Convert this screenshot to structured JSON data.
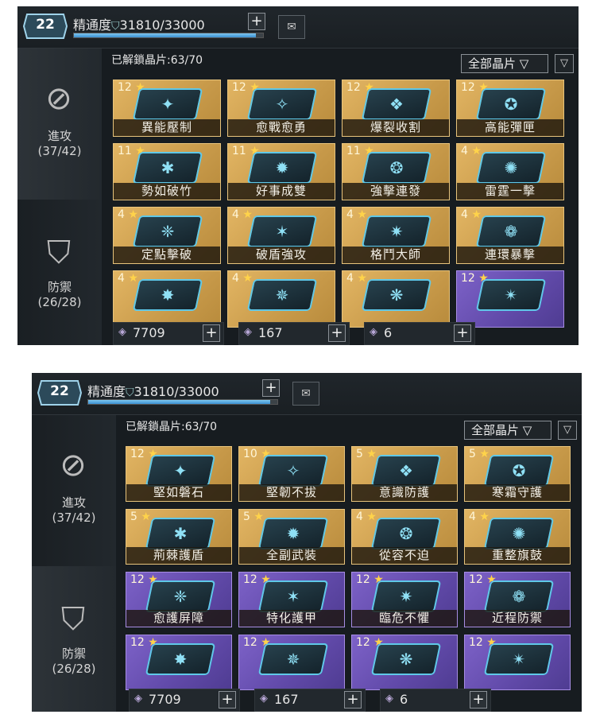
{
  "screens": [
    {
      "level": "22",
      "mastery_label": "精通度",
      "mastery_value": "31810/33000",
      "mastery_progress": 0.964,
      "unlocked_label": "已解鎖晶片:63/70",
      "filter_label": "全部晶片",
      "tabs": [
        {
          "label": "進攻",
          "count": "(37/42)",
          "icon": "attack-icon",
          "selected": true
        },
        {
          "label": "防禦",
          "count": "(26/28)",
          "icon": "shield-icon",
          "selected": false
        }
      ],
      "chips": [
        {
          "level": "12",
          "name": "異能壓制",
          "rarity": "gold"
        },
        {
          "level": "12",
          "name": "愈戰愈勇",
          "rarity": "gold"
        },
        {
          "level": "12",
          "name": "爆裂收割",
          "rarity": "gold"
        },
        {
          "level": "12",
          "name": "高能彈匣",
          "rarity": "gold"
        },
        {
          "level": "11",
          "name": "勢如破竹",
          "rarity": "gold"
        },
        {
          "level": "11",
          "name": "好事成雙",
          "rarity": "gold"
        },
        {
          "level": "11",
          "name": "強擊連發",
          "rarity": "gold"
        },
        {
          "level": "4",
          "name": "雷霆一擊",
          "rarity": "gold"
        },
        {
          "level": "4",
          "name": "定點擊破",
          "rarity": "gold"
        },
        {
          "level": "4",
          "name": "破盾強攻",
          "rarity": "gold"
        },
        {
          "level": "4",
          "name": "格鬥大師",
          "rarity": "gold"
        },
        {
          "level": "4",
          "name": "連環暴擊",
          "rarity": "gold"
        },
        {
          "level": "4",
          "name": "",
          "rarity": "gold"
        },
        {
          "level": "4",
          "name": "",
          "rarity": "gold"
        },
        {
          "level": "4",
          "name": "",
          "rarity": "gold"
        },
        {
          "level": "12",
          "name": "",
          "rarity": "purple"
        }
      ],
      "resources": [
        {
          "value": "7709",
          "icon": "chip-material-icon"
        },
        {
          "value": "167",
          "icon": "purple-material-icon"
        },
        {
          "value": "6",
          "icon": "gold-material-icon"
        }
      ]
    },
    {
      "level": "22",
      "mastery_label": "精通度",
      "mastery_value": "31810/33000",
      "mastery_progress": 0.964,
      "unlocked_label": "已解鎖晶片:63/70",
      "filter_label": "全部晶片",
      "tabs": [
        {
          "label": "進攻",
          "count": "(37/42)",
          "icon": "attack-icon",
          "selected": false
        },
        {
          "label": "防禦",
          "count": "(26/28)",
          "icon": "shield-icon",
          "selected": true
        }
      ],
      "chips": [
        {
          "level": "12",
          "name": "堅如磐石",
          "rarity": "gold"
        },
        {
          "level": "10",
          "name": "堅韌不拔",
          "rarity": "gold"
        },
        {
          "level": "5",
          "name": "意識防護",
          "rarity": "gold"
        },
        {
          "level": "5",
          "name": "寒霜守護",
          "rarity": "gold"
        },
        {
          "level": "5",
          "name": "荊棘護盾",
          "rarity": "gold"
        },
        {
          "level": "5",
          "name": "全副武裝",
          "rarity": "gold"
        },
        {
          "level": "4",
          "name": "從容不迫",
          "rarity": "gold"
        },
        {
          "level": "4",
          "name": "重整旗鼓",
          "rarity": "gold"
        },
        {
          "level": "12",
          "name": "愈護屏障",
          "rarity": "purple"
        },
        {
          "level": "12",
          "name": "特化護甲",
          "rarity": "purple"
        },
        {
          "level": "12",
          "name": "臨危不懼",
          "rarity": "purple"
        },
        {
          "level": "12",
          "name": "近程防禦",
          "rarity": "purple"
        },
        {
          "level": "12",
          "name": "",
          "rarity": "purple"
        },
        {
          "level": "12",
          "name": "",
          "rarity": "purple"
        },
        {
          "level": "12",
          "name": "",
          "rarity": "purple"
        },
        {
          "level": "12",
          "name": "",
          "rarity": "purple"
        }
      ],
      "resources": [
        {
          "value": "7709",
          "icon": "chip-material-icon"
        },
        {
          "value": "167",
          "icon": "purple-material-icon"
        },
        {
          "value": "6",
          "icon": "gold-material-icon"
        }
      ]
    }
  ]
}
